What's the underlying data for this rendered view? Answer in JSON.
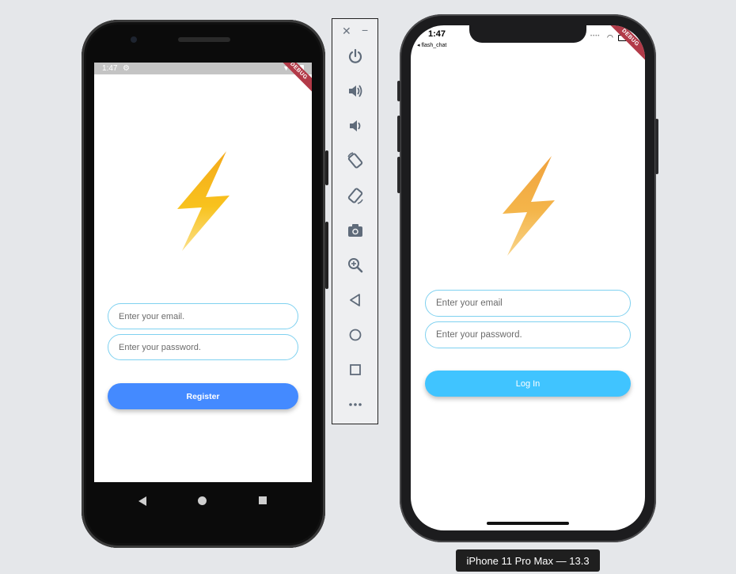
{
  "android": {
    "status_time": "1:47",
    "debug_banner": "DEBUG",
    "email_placeholder": "Enter your email.",
    "password_placeholder": "Enter your password.",
    "primary_button": "Register",
    "button_color": "#448aff",
    "bolt_color": "#f6b81d"
  },
  "toolbar": {
    "items": [
      "power-icon",
      "volume-up-icon",
      "volume-down-icon",
      "rotate-left-icon",
      "rotate-right-icon",
      "camera-icon",
      "zoom-icon",
      "back-icon",
      "home-icon",
      "overview-icon",
      "more-icon"
    ]
  },
  "iphone": {
    "status_time": "1:47",
    "back_app": "◂ flash_chat",
    "debug_banner": "DEBUG",
    "email_placeholder": "Enter your email",
    "password_placeholder": "Enter your password.",
    "primary_button": "Log In",
    "button_color": "#40c4ff",
    "bolt_color": "#f2b24c"
  },
  "device_label": "iPhone 11 Pro Max — 13.3"
}
